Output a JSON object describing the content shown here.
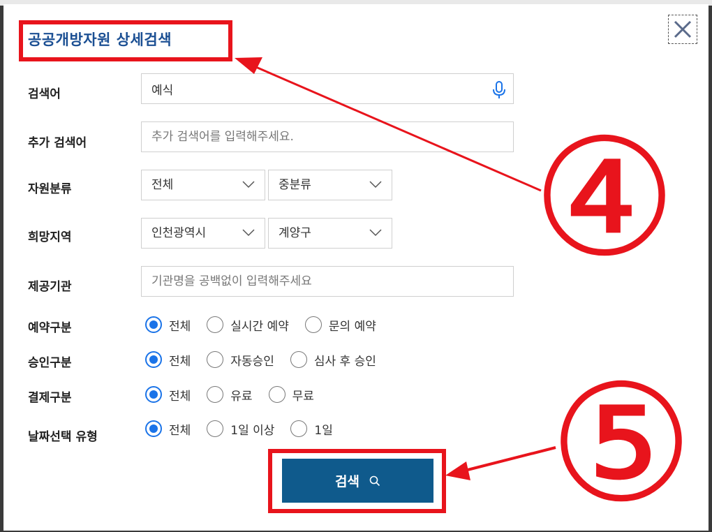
{
  "modal": {
    "title": "공공개방자원 상세검색",
    "close_icon": "close-icon"
  },
  "form": {
    "keyword": {
      "label": "검색어",
      "value": "예식"
    },
    "extra_keyword": {
      "label": "추가 검색어",
      "placeholder": "추가 검색어를 입력해주세요."
    },
    "category": {
      "label": "자원분류",
      "major": "전체",
      "minor": "중분류"
    },
    "region": {
      "label": "희망지역",
      "city": "인천광역시",
      "district": "계양구"
    },
    "provider": {
      "label": "제공기관",
      "placeholder": "기관명을 공백없이 입력해주세요"
    },
    "reservation_type": {
      "label": "예약구분",
      "options": [
        "전체",
        "실시간 예약",
        "문의 예약"
      ],
      "selected": 0
    },
    "approval_type": {
      "label": "승인구분",
      "options": [
        "전체",
        "자동승인",
        "심사 후 승인"
      ],
      "selected": 0
    },
    "payment_type": {
      "label": "결제구분",
      "options": [
        "전체",
        "유료",
        "무료"
      ],
      "selected": 0
    },
    "date_type": {
      "label": "날짜선택 유형",
      "options": [
        "전체",
        "1일 이상",
        "1일"
      ],
      "selected": 0
    }
  },
  "search_button": {
    "label": "검색"
  },
  "annotations": {
    "step4": "④",
    "step5": "⑤",
    "color": "#e8141c"
  },
  "colors": {
    "title": "#1b4f93",
    "button": "#0f5a8c",
    "radio_on": "#1a73e8"
  }
}
